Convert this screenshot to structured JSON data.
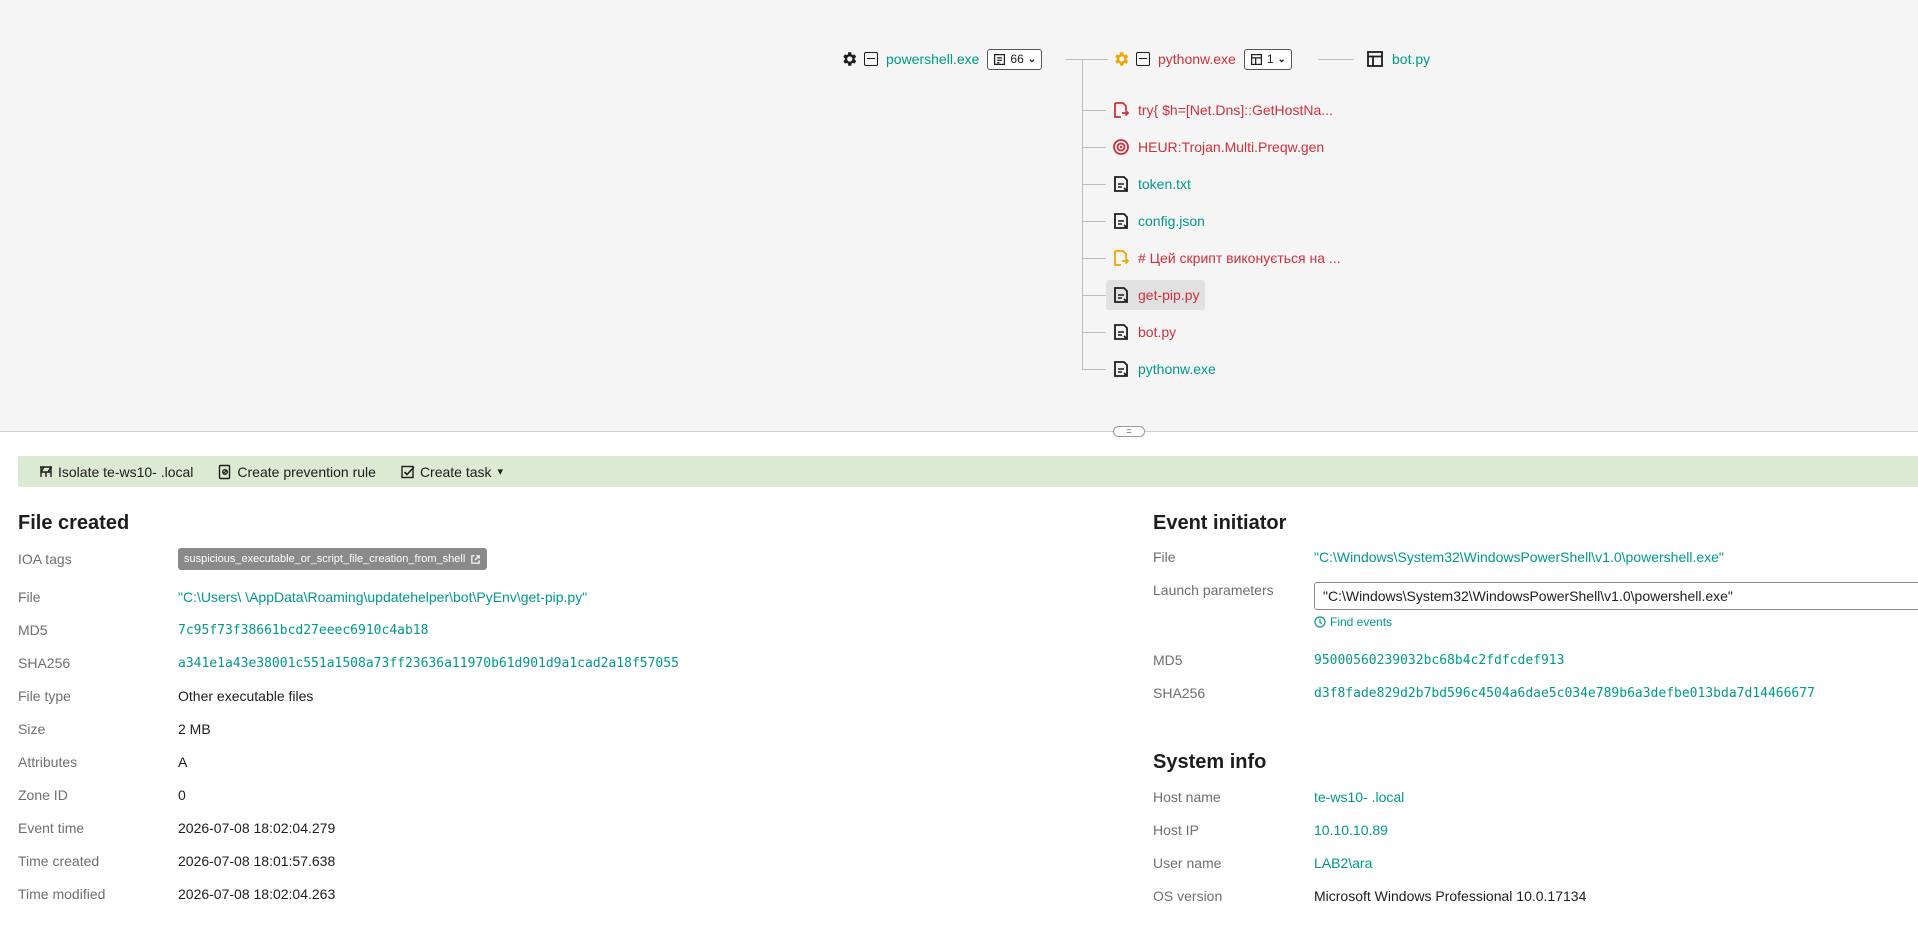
{
  "tree": {
    "root": {
      "name": "powershell.exe",
      "count": "66"
    },
    "process": {
      "name": "pythonw.exe",
      "count": "1"
    },
    "target": {
      "name": "bot.py"
    },
    "children": [
      {
        "label": "try{ $h=[Net.Dns]::GetHostNa...",
        "color": "#d12f3c",
        "icon": "script-run-icon"
      },
      {
        "label": "HEUR:Trojan.Multi.Preqw.gen",
        "color": "#d12f3c",
        "icon": "threat-target-icon"
      },
      {
        "label": "token.txt",
        "color": "#00998a",
        "icon": "file-write-icon"
      },
      {
        "label": "config.json",
        "color": "#00998a",
        "icon": "file-write-icon"
      },
      {
        "label": "# Цей скрипт виконується на ...",
        "color": "#d12f3c",
        "icon": "script-warning-icon"
      },
      {
        "label": "get-pip.py",
        "color": "#d12f3c",
        "icon": "file-write-icon",
        "selected": true
      },
      {
        "label": "bot.py",
        "color": "#d12f3c",
        "icon": "file-write-icon"
      },
      {
        "label": "pythonw.exe",
        "color": "#00998a",
        "icon": "file-write-icon"
      }
    ]
  },
  "actions": {
    "isolate_label": "Isolate te-ws10-            .local",
    "prevention_label": "Create prevention rule",
    "task_label": "Create task"
  },
  "file_created": {
    "title": "File created",
    "ioa_label": "IOA tags",
    "ioa_tag": "suspicious_executable_or_script_file_creation_from_shell",
    "file_label": "File",
    "file_value": "\"C:\\Users\\      \\AppData\\Roaming\\updatehelper\\bot\\PyEnv\\get-pip.py\"",
    "md5_label": "MD5",
    "md5_value": "7c95f73f38661bcd27eeec6910c4ab18",
    "sha_label": "SHA256",
    "sha_value": "a341e1a43e38001c551a1508a73ff23636a11970b61d901d9a1cad2a18f57055",
    "type_label": "File type",
    "type_value": "Other executable files",
    "size_label": "Size",
    "size_value": "2 MB",
    "attr_label": "Attributes",
    "attr_value": "A",
    "zone_label": "Zone ID",
    "zone_value": "0",
    "event_time_label": "Event time",
    "event_time_value": "2026-07-08 18:02:04.279",
    "created_label": "Time created",
    "created_value": "2026-07-08 18:01:57.638",
    "modified_label": "Time modified",
    "modified_value": "2026-07-08 18:02:04.263"
  },
  "event_initiator": {
    "title": "Event initiator",
    "file_label": "File",
    "file_value": "\"C:\\Windows\\System32\\WindowsPowerShell\\v1.0\\powershell.exe\"",
    "launch_label": "Launch parameters",
    "launch_value": "\"C:\\Windows\\System32\\WindowsPowerShell\\v1.0\\powershell.exe\"",
    "find_events": "Find events",
    "md5_label": "MD5",
    "md5_value": "95000560239032bc68b4c2fdfcdef913",
    "sha_label": "SHA256",
    "sha_value": "d3f8fade829d2b7bd596c4504a6dae5c034e789b6a3defbe013bda7d14466677"
  },
  "system_info": {
    "title": "System info",
    "host_label": "Host name",
    "host_value": "te-ws10-            .local",
    "ip_label": "Host IP",
    "ip_value": "10.10.10.89",
    "user_label": "User name",
    "user_value": "LAB2\\ara",
    "os_label": "OS version",
    "os_value": "Microsoft Windows Professional 10.0.17134"
  },
  "colors": {
    "accent": "#00998a",
    "danger": "#d12f3c",
    "warning": "#f0a500",
    "action_bar": "#dce9d3"
  }
}
